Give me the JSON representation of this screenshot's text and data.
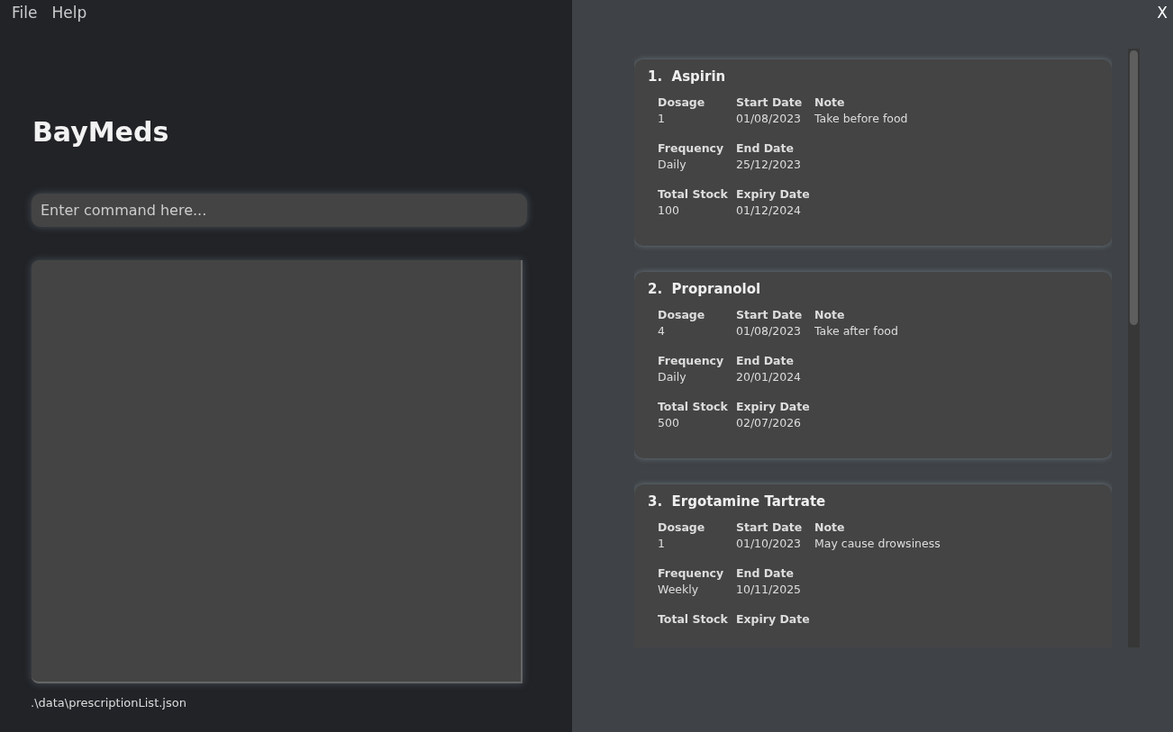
{
  "menu": [
    {
      "label": "File"
    },
    {
      "label": "Help"
    }
  ],
  "close": "X",
  "app_title": "BayMeds",
  "command": {
    "placeholder": "Enter command here..."
  },
  "status_bar": ".\\data\\prescriptionList.json",
  "prescriptions": [
    {
      "index": "1.",
      "name": "Aspirin",
      "rows": [
        [
          {
            "label": "Dosage",
            "value": "1"
          },
          {
            "label": "Start Date",
            "value": "01/08/2023"
          },
          {
            "label": "Note",
            "value": "Take before food"
          }
        ],
        [
          {
            "label": "Frequency",
            "value": "Daily"
          },
          {
            "label": "End Date",
            "value": "25/12/2023"
          }
        ],
        [
          {
            "label": "Total Stock",
            "value": "100"
          },
          {
            "label": "Expiry Date",
            "value": "01/12/2024"
          }
        ]
      ]
    },
    {
      "index": "2.",
      "name": "Propranolol",
      "rows": [
        [
          {
            "label": "Dosage",
            "value": "4"
          },
          {
            "label": "Start Date",
            "value": "01/08/2023"
          },
          {
            "label": "Note",
            "value": "Take after food"
          }
        ],
        [
          {
            "label": "Frequency",
            "value": "Daily"
          },
          {
            "label": "End Date",
            "value": "20/01/2024"
          }
        ],
        [
          {
            "label": "Total Stock",
            "value": "500"
          },
          {
            "label": "Expiry Date",
            "value": "02/07/2026"
          }
        ]
      ]
    },
    {
      "index": "3.",
      "name": "Ergotamine Tartrate",
      "rows": [
        [
          {
            "label": "Dosage",
            "value": "1"
          },
          {
            "label": "Start Date",
            "value": "01/10/2023"
          },
          {
            "label": "Note",
            "value": "May cause drowsiness"
          }
        ],
        [
          {
            "label": "Frequency",
            "value": "Weekly"
          },
          {
            "label": "End Date",
            "value": "10/11/2025"
          }
        ],
        [
          {
            "label": "Total Stock"
          },
          {
            "label": "Expiry Date"
          }
        ]
      ]
    }
  ]
}
